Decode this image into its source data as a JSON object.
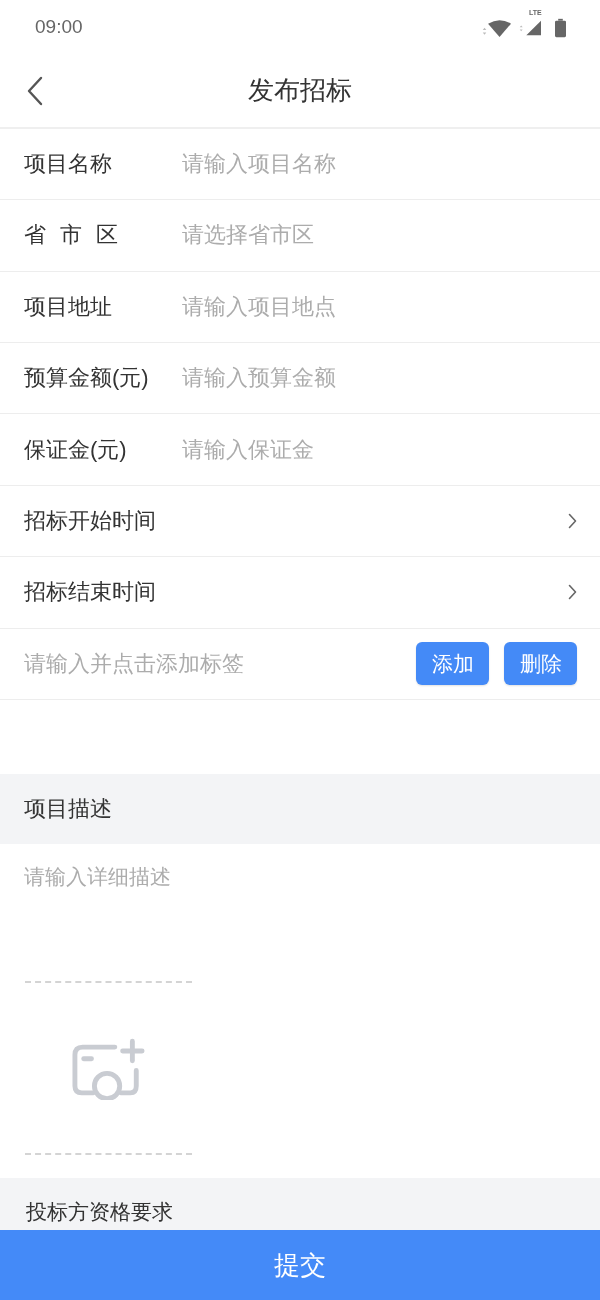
{
  "status_bar": {
    "time": "09:00",
    "network": "LTE"
  },
  "header": {
    "title": "发布招标"
  },
  "form_rows": [
    {
      "kind": "input",
      "label": "项目名称",
      "placeholder": "请输入项目名称"
    },
    {
      "kind": "input",
      "label": "省 市 区",
      "placeholder": "请选择省市区"
    },
    {
      "kind": "input",
      "label": "项目地址",
      "placeholder": "请输入项目地点"
    },
    {
      "kind": "input",
      "label": "预算金额(元)",
      "placeholder": "请输入预算金额"
    },
    {
      "kind": "input",
      "label": "保证金(元)",
      "placeholder": "请输入保证金"
    },
    {
      "kind": "picker",
      "label": "招标开始时间"
    },
    {
      "kind": "picker",
      "label": "招标结束时间"
    }
  ],
  "tags": {
    "placeholder": "请输入并点击添加标签",
    "buttons": [
      "添加",
      "删除"
    ]
  },
  "description": {
    "heading": "项目描述",
    "placeholder": "请输入详细描述"
  },
  "qualification": {
    "heading": "投标方资格要求"
  },
  "submit": {
    "label": "提交"
  }
}
